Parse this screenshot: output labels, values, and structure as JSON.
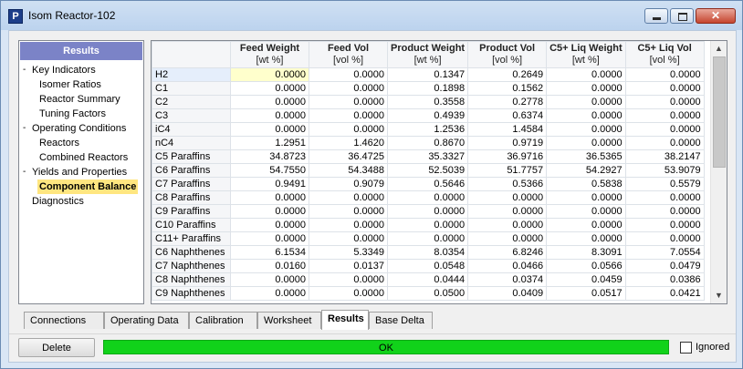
{
  "window": {
    "title": "Isom Reactor-102",
    "app_icon_letter": "P",
    "close_glyph": "✕"
  },
  "tree": {
    "header": "Results",
    "items": [
      {
        "label": "Key Indicators",
        "toggle": "-"
      },
      {
        "label": "Isomer Ratios"
      },
      {
        "label": "Reactor Summary"
      },
      {
        "label": "Tuning Factors"
      },
      {
        "label": "Operating Conditions",
        "toggle": "-"
      },
      {
        "label": "Reactors"
      },
      {
        "label": "Combined Reactors"
      },
      {
        "label": "Yields and Properties",
        "toggle": "-"
      },
      {
        "label": "Component Balance",
        "selected": true
      },
      {
        "label": "Diagnostics"
      }
    ]
  },
  "grid": {
    "columns": [
      {
        "name": "Feed Weight",
        "unit": "[wt %]"
      },
      {
        "name": "Feed Vol",
        "unit": "[vol %]"
      },
      {
        "name": "Product Weight",
        "unit": "[wt %]"
      },
      {
        "name": "Product Vol",
        "unit": "[vol %]"
      },
      {
        "name": "C5+ Liq Weight",
        "unit": "[wt %]"
      },
      {
        "name": "C5+ Liq Vol",
        "unit": "[vol %]"
      }
    ],
    "rows": [
      {
        "name": "H2",
        "values": [
          "0.0000",
          "0.0000",
          "0.1347",
          "0.2649",
          "0.0000",
          "0.0000"
        ]
      },
      {
        "name": "C1",
        "values": [
          "0.0000",
          "0.0000",
          "0.1898",
          "0.1562",
          "0.0000",
          "0.0000"
        ]
      },
      {
        "name": "C2",
        "values": [
          "0.0000",
          "0.0000",
          "0.3558",
          "0.2778",
          "0.0000",
          "0.0000"
        ]
      },
      {
        "name": "C3",
        "values": [
          "0.0000",
          "0.0000",
          "0.4939",
          "0.6374",
          "0.0000",
          "0.0000"
        ]
      },
      {
        "name": "iC4",
        "values": [
          "0.0000",
          "0.0000",
          "1.2536",
          "1.4584",
          "0.0000",
          "0.0000"
        ]
      },
      {
        "name": "nC4",
        "values": [
          "1.2951",
          "1.4620",
          "0.8670",
          "0.9719",
          "0.0000",
          "0.0000"
        ]
      },
      {
        "name": "C5 Paraffins",
        "values": [
          "34.8723",
          "36.4725",
          "35.3327",
          "36.9716",
          "36.5365",
          "38.2147"
        ]
      },
      {
        "name": "C6 Paraffins",
        "values": [
          "54.7550",
          "54.3488",
          "52.5039",
          "51.7757",
          "54.2927",
          "53.9079"
        ]
      },
      {
        "name": "C7 Paraffins",
        "values": [
          "0.9491",
          "0.9079",
          "0.5646",
          "0.5366",
          "0.5838",
          "0.5579"
        ]
      },
      {
        "name": "C8 Paraffins",
        "values": [
          "0.0000",
          "0.0000",
          "0.0000",
          "0.0000",
          "0.0000",
          "0.0000"
        ]
      },
      {
        "name": "C9 Paraffins",
        "values": [
          "0.0000",
          "0.0000",
          "0.0000",
          "0.0000",
          "0.0000",
          "0.0000"
        ]
      },
      {
        "name": "C10 Paraffins",
        "values": [
          "0.0000",
          "0.0000",
          "0.0000",
          "0.0000",
          "0.0000",
          "0.0000"
        ]
      },
      {
        "name": "C11+ Paraffins",
        "values": [
          "0.0000",
          "0.0000",
          "0.0000",
          "0.0000",
          "0.0000",
          "0.0000"
        ]
      },
      {
        "name": "C6 Naphthenes",
        "values": [
          "6.1534",
          "5.3349",
          "8.0354",
          "6.8246",
          "8.3091",
          "7.0554"
        ]
      },
      {
        "name": "C7 Naphthenes",
        "values": [
          "0.0160",
          "0.0137",
          "0.0548",
          "0.0466",
          "0.0566",
          "0.0479"
        ]
      },
      {
        "name": "C8 Naphthenes",
        "values": [
          "0.0000",
          "0.0000",
          "0.0444",
          "0.0374",
          "0.0459",
          "0.0386"
        ]
      },
      {
        "name": "C9 Naphthenes",
        "values": [
          "0.0000",
          "0.0000",
          "0.0500",
          "0.0409",
          "0.0517",
          "0.0421"
        ]
      }
    ]
  },
  "tabs": [
    {
      "label": "Connections"
    },
    {
      "label": "Operating Data"
    },
    {
      "label": "Calibration"
    },
    {
      "label": "Worksheet"
    },
    {
      "label": "Results",
      "active": true
    },
    {
      "label": "Base Delta"
    }
  ],
  "footer": {
    "delete_label": "Delete",
    "status_text": "OK",
    "status_color": "#11d21a",
    "ignored_label": "Ignored",
    "ignored_checked": false
  }
}
